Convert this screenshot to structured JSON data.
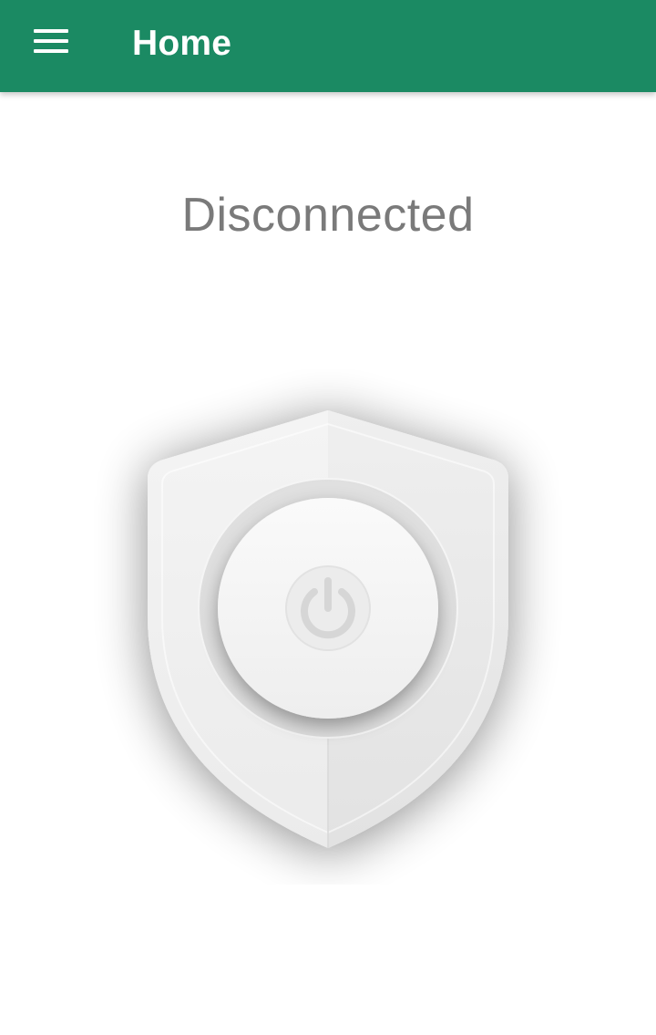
{
  "app_bar": {
    "title": "Home",
    "menu_icon": "hamburger-menu-icon",
    "background_color": "#1b8a63"
  },
  "main": {
    "status": "Disconnected",
    "status_color": "#7a7a7a",
    "shield_icon": "shield-icon",
    "power_icon": "power-icon"
  }
}
